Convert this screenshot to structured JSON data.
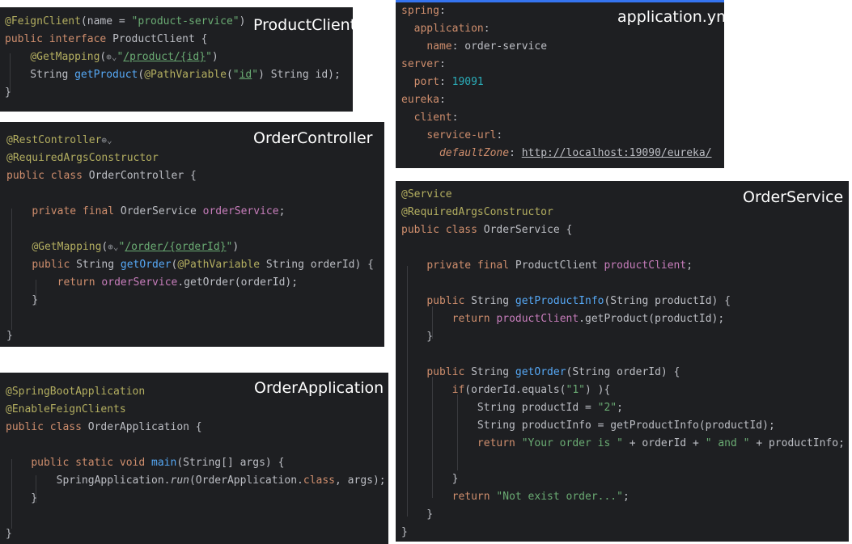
{
  "panels": {
    "product_client": {
      "title": "ProductClient",
      "lines": [
        [
          [
            "an",
            "@FeignClient"
          ],
          [
            "p",
            "(name = "
          ],
          [
            "st",
            "\"product-service\""
          ],
          [
            "p",
            ")"
          ]
        ],
        [
          [
            "kw",
            "public interface "
          ],
          [
            "p",
            "ProductClient {"
          ]
        ],
        [
          [
            "p",
            "    "
          ],
          [
            "an",
            "@GetMapping"
          ],
          [
            "p",
            "("
          ],
          [
            "globe",
            "⊕⌄"
          ],
          [
            "st",
            "\""
          ],
          [
            "stu",
            "/product/{id}"
          ],
          [
            "st",
            "\""
          ],
          [
            "p",
            ")"
          ]
        ],
        [
          [
            "p",
            "    String "
          ],
          [
            "fn",
            "getProduct"
          ],
          [
            "p",
            "("
          ],
          [
            "an",
            "@PathVariable"
          ],
          [
            "p",
            "("
          ],
          [
            "st",
            "\""
          ],
          [
            "stu",
            "id"
          ],
          [
            "st",
            "\""
          ],
          [
            "p",
            ") String id);"
          ]
        ],
        [
          [
            "p",
            "}"
          ]
        ]
      ]
    },
    "order_controller": {
      "title": "OrderController",
      "lines": [
        [
          [
            "an",
            "@RestController"
          ],
          [
            "globe",
            "⊕⌄"
          ]
        ],
        [
          [
            "an",
            "@RequiredArgsConstructor"
          ]
        ],
        [
          [
            "kw",
            "public class "
          ],
          [
            "p",
            "OrderController {"
          ]
        ],
        [],
        [
          [
            "p",
            "    "
          ],
          [
            "kw",
            "private final "
          ],
          [
            "p",
            "OrderService "
          ],
          [
            "fd",
            "orderService"
          ],
          [
            "p",
            ";"
          ]
        ],
        [],
        [
          [
            "p",
            "    "
          ],
          [
            "an",
            "@GetMapping"
          ],
          [
            "p",
            "("
          ],
          [
            "globe",
            "⊕⌄"
          ],
          [
            "st",
            "\""
          ],
          [
            "stu",
            "/order/{orderId}"
          ],
          [
            "st",
            "\""
          ],
          [
            "p",
            ")"
          ]
        ],
        [
          [
            "p",
            "    "
          ],
          [
            "kw",
            "public "
          ],
          [
            "p",
            "String "
          ],
          [
            "fn",
            "getOrder"
          ],
          [
            "p",
            "("
          ],
          [
            "an",
            "@PathVariable"
          ],
          [
            "p",
            " String orderId) {"
          ]
        ],
        [
          [
            "p",
            "        "
          ],
          [
            "kw",
            "return "
          ],
          [
            "fd",
            "orderService"
          ],
          [
            "p",
            ".getOrder(orderId);"
          ]
        ],
        [
          [
            "p",
            "    }"
          ]
        ],
        [],
        [
          [
            "p",
            "}"
          ]
        ]
      ]
    },
    "order_application": {
      "title": "OrderApplication",
      "lines": [
        [
          [
            "an",
            "@SpringBootApplication"
          ]
        ],
        [
          [
            "an",
            "@EnableFeignClients"
          ]
        ],
        [
          [
            "kw",
            "public class "
          ],
          [
            "p",
            "OrderApplication {"
          ]
        ],
        [],
        [
          [
            "p",
            "    "
          ],
          [
            "kw",
            "public static void "
          ],
          [
            "fn",
            "main"
          ],
          [
            "p",
            "(String[] args) {"
          ]
        ],
        [
          [
            "p",
            "        SpringApplication."
          ],
          [
            "it",
            "run"
          ],
          [
            "p",
            "(OrderApplication."
          ],
          [
            "kw",
            "class"
          ],
          [
            "p",
            ", args);"
          ]
        ],
        [
          [
            "p",
            "    }"
          ]
        ],
        [],
        [
          [
            "p",
            "}"
          ]
        ]
      ]
    },
    "application_yml": {
      "title": "application.yml",
      "lines": [
        [
          [
            "yk",
            "spring"
          ],
          [
            "p",
            ":"
          ]
        ],
        [
          [
            "p",
            "  "
          ],
          [
            "yk",
            "application"
          ],
          [
            "p",
            ":"
          ]
        ],
        [
          [
            "p",
            "    "
          ],
          [
            "yk",
            "name"
          ],
          [
            "p",
            ": order-service"
          ]
        ],
        [
          [
            "yk",
            "server"
          ],
          [
            "p",
            ":"
          ]
        ],
        [
          [
            "p",
            "  "
          ],
          [
            "yk",
            "port"
          ],
          [
            "p",
            ": "
          ],
          [
            "num",
            "19091"
          ]
        ],
        [
          [
            "yk",
            "eureka"
          ],
          [
            "p",
            ":"
          ]
        ],
        [
          [
            "p",
            "  "
          ],
          [
            "yk",
            "client"
          ],
          [
            "p",
            ":"
          ]
        ],
        [
          [
            "p",
            "    "
          ],
          [
            "yk",
            "service-url"
          ],
          [
            "p",
            ":"
          ]
        ],
        [
          [
            "p",
            "      "
          ],
          [
            "yki",
            "defaultZone"
          ],
          [
            "p",
            ": "
          ],
          [
            "pu",
            "http://localhost:19090/eureka/"
          ]
        ]
      ]
    },
    "order_service": {
      "title": "OrderService",
      "lines": [
        [
          [
            "an",
            "@Service"
          ]
        ],
        [
          [
            "an",
            "@RequiredArgsConstructor"
          ]
        ],
        [
          [
            "kw",
            "public class "
          ],
          [
            "p",
            "OrderService {"
          ]
        ],
        [],
        [
          [
            "p",
            "    "
          ],
          [
            "kw",
            "private final "
          ],
          [
            "p",
            "ProductClient "
          ],
          [
            "fd",
            "productClient"
          ],
          [
            "p",
            ";"
          ]
        ],
        [],
        [
          [
            "p",
            "    "
          ],
          [
            "kw",
            "public "
          ],
          [
            "p",
            "String "
          ],
          [
            "fn",
            "getProductInfo"
          ],
          [
            "p",
            "(String productId) {"
          ]
        ],
        [
          [
            "p",
            "        "
          ],
          [
            "kw",
            "return "
          ],
          [
            "fd",
            "productClient"
          ],
          [
            "p",
            ".getProduct(productId);"
          ]
        ],
        [
          [
            "p",
            "    }"
          ]
        ],
        [],
        [
          [
            "p",
            "    "
          ],
          [
            "kw",
            "public "
          ],
          [
            "p",
            "String "
          ],
          [
            "fn",
            "getOrder"
          ],
          [
            "p",
            "(String orderId) {"
          ]
        ],
        [
          [
            "p",
            "        "
          ],
          [
            "kw",
            "if"
          ],
          [
            "p",
            "(orderId.equals("
          ],
          [
            "st",
            "\"1\""
          ],
          [
            "p",
            ") ){"
          ]
        ],
        [
          [
            "p",
            "            String productId = "
          ],
          [
            "st",
            "\"2\""
          ],
          [
            "p",
            ";"
          ]
        ],
        [
          [
            "p",
            "            String productInfo = getProductInfo(productId);"
          ]
        ],
        [
          [
            "p",
            "            "
          ],
          [
            "kw",
            "return "
          ],
          [
            "st",
            "\"Your order is \""
          ],
          [
            "p",
            " + orderId + "
          ],
          [
            "st",
            "\" and \""
          ],
          [
            "p",
            " + productInfo;"
          ]
        ],
        [],
        [
          [
            "p",
            "        }"
          ]
        ],
        [
          [
            "p",
            "        "
          ],
          [
            "kw",
            "return "
          ],
          [
            "st",
            "\"Not exist order...\""
          ],
          [
            "p",
            ";"
          ]
        ],
        [
          [
            "p",
            "    }"
          ]
        ],
        [
          [
            "p",
            "}"
          ]
        ]
      ]
    }
  }
}
